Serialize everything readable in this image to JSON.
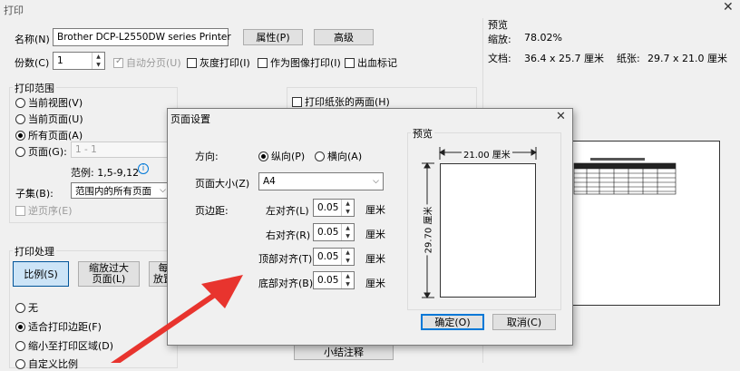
{
  "window": {
    "title": "打印"
  },
  "print": {
    "printer_name_label": "名称(N)",
    "printer_value": "Brother DCP-L2550DW series Printer",
    "properties_button": "属性(P)",
    "advanced_button": "高级",
    "copies_label": "份数(C)",
    "copies_value": "1",
    "collate_label": "自动分页(U)",
    "grayscale_label": "灰度打印(I)",
    "print_as_image_label": "作为图像打印(I)",
    "print_to_file_label": "出血标记",
    "range_group_label": "打印范围",
    "range_current_view": "当前视图(V)",
    "range_current_page": "当前页面(U)",
    "range_all_pages": "所有页面(A)",
    "range_pages": "页面(G):",
    "pages_input_placeholder": "1 - 1",
    "example_label": "范例: 1,5-9,12",
    "subset_label": "子集(B):",
    "subset_value": "范围内的所有页面",
    "reverse_label": "逆页序(E)",
    "duplex_label": "打印纸张的两面(H)",
    "handling_group_label": "打印处理",
    "scale_button": "比例(S)",
    "shrink_button_line1": "缩放过大",
    "shrink_button_line2": "页面(L)",
    "multi_button_line1": "每",
    "multi_button_line2": "放置",
    "opt_none": "无",
    "opt_fit_margin": "适合打印边距(F)",
    "opt_shrink_area": "缩小至打印区域(D)",
    "opt_custom": "自定义比例",
    "summary_button": "小结注释"
  },
  "preview": {
    "title": "预览",
    "zoom_label": "缩放:",
    "zoom_value": "78.02%",
    "doc_label": "文档:",
    "doc_value": "36.4 x 25.7 厘米",
    "paper_label": "纸张:",
    "paper_value": "29.7 x 21.0 厘米"
  },
  "page_setup": {
    "title": "页面设置",
    "orientation_label": "方向:",
    "portrait_label": "纵向(P)",
    "landscape_label": "横向(A)",
    "paper_size_label": "页面大小(Z)",
    "paper_size_value": "A4",
    "margins_label": "页边距:",
    "left_label": "左对齐(L)",
    "left_value": "0.05",
    "right_label": "右对齐(R)",
    "right_value": "0.05",
    "top_label": "顶部对齐(T)",
    "top_value": "0.05",
    "bottom_label": "底部对齐(B)",
    "bottom_value": "0.05",
    "unit": "厘米",
    "preview_label": "预览",
    "width_dim": "21.00 厘米",
    "height_dim": "29.70 厘米",
    "ok_button": "确定(O)",
    "cancel_button": "取消(C)"
  },
  "colors": {
    "arrow": "#e8342e",
    "accent": "#0078d7"
  }
}
